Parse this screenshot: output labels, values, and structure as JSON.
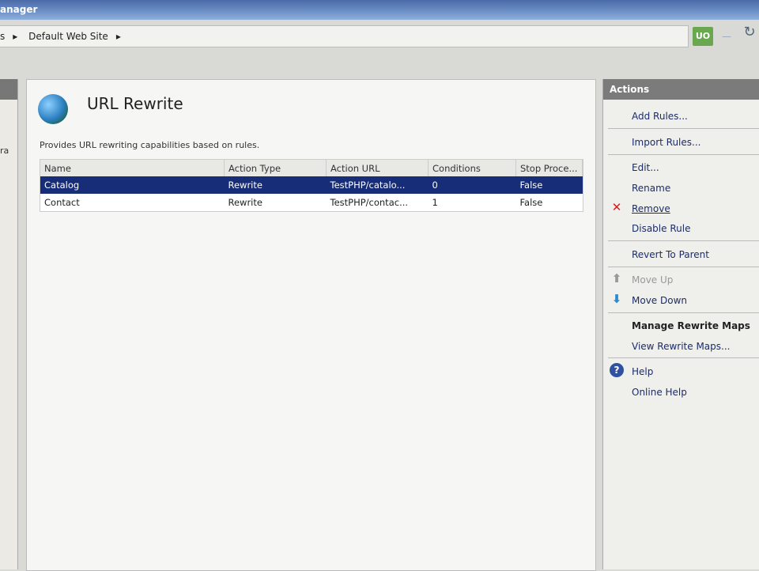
{
  "window": {
    "title": "anager"
  },
  "address": {
    "crumbs": [
      "s",
      "Default Web Site"
    ],
    "status_label": "UO"
  },
  "leftpane": {
    "text": "ra"
  },
  "feature": {
    "title": "URL Rewrite",
    "description": "Provides URL rewriting capabilities based on rules."
  },
  "rules": {
    "columns": [
      "Name",
      "Action Type",
      "Action URL",
      "Conditions",
      "Stop Proce..."
    ],
    "rows": [
      [
        "Catalog",
        "Rewrite",
        "TestPHP/catalo...",
        "0",
        "False"
      ],
      [
        "Contact",
        "Rewrite",
        "TestPHP/contac...",
        "1",
        "False"
      ]
    ],
    "selected": 0
  },
  "actions": {
    "header": "Actions",
    "items": [
      "Add Rules...",
      "Import Rules...",
      "Edit...",
      "Rename",
      "Remove",
      "Disable Rule",
      "Revert To Parent",
      "Move Up",
      "Move Down",
      "Manage Rewrite Maps",
      "View Rewrite Maps...",
      "Help",
      "Online Help"
    ]
  },
  "colors": {
    "selection": "#172d78",
    "link": "#1c2c6a",
    "remove": "#d02020"
  }
}
